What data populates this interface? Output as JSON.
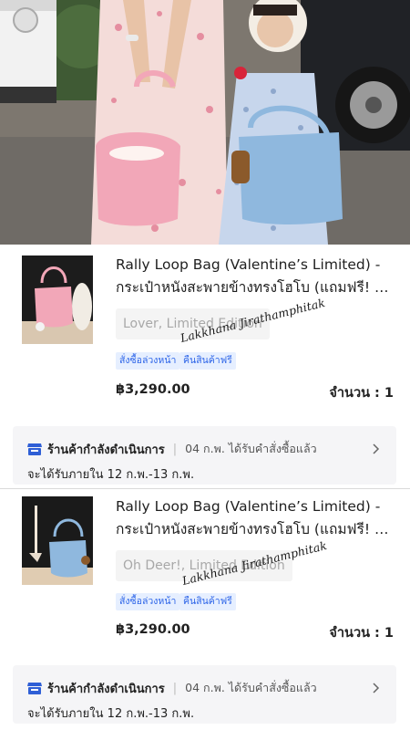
{
  "hero": {
    "description_icon": "product-lifestyle-photo"
  },
  "orders": [
    {
      "product_name_line1": "Rally Loop Bag (Valentine’s Limited) -",
      "product_name_line2": "กระเป๋าหนังสะพายข้างทรงโฮโบ (แถมฟรี! Ba…",
      "variant": "Lover, Limited Edition",
      "watermark": "Lakkhana Jirathamphitak",
      "tags": [
        "สั่งซื้อล่วงหน้า",
        "คืนสินค้าฟรี"
      ],
      "price": "฿3,290.00",
      "quantity_label": "จำนวน : 1",
      "status_title": "ร้านค้ากำลังดำเนินการ",
      "status_separator": "|",
      "status_date": "04 ก.พ. ได้รับคำสั่งซื้อแล้ว",
      "eta": "จะได้รับภายใน 12 ก.พ.-13 ก.พ.",
      "bag_color": "#f2a7b8"
    },
    {
      "product_name_line1": "Rally Loop Bag (Valentine’s Limited) -",
      "product_name_line2": "กระเป๋าหนังสะพายข้างทรงโฮโบ (แถมฟรี! Bag…",
      "variant": "Oh Deer!, Limited Edition",
      "watermark": "Lakkhana Jirathamphitak",
      "tags": [
        "สั่งซื้อล่วงหน้า",
        "คืนสินค้าฟรี"
      ],
      "price": "฿3,290.00",
      "quantity_label": "จำนวน : 1",
      "status_title": "ร้านค้ากำลังดำเนินการ",
      "status_separator": "|",
      "status_date": "04 ก.พ. ได้รับคำสั่งซื้อแล้ว",
      "eta": "จะได้รับภายใน 12 ก.พ.-13 ก.พ.",
      "bag_color": "#8fb8de"
    }
  ],
  "colors": {
    "tag_bg": "#e6efff",
    "tag_text": "#2c64e8",
    "store_icon": "#2f5fd6"
  }
}
